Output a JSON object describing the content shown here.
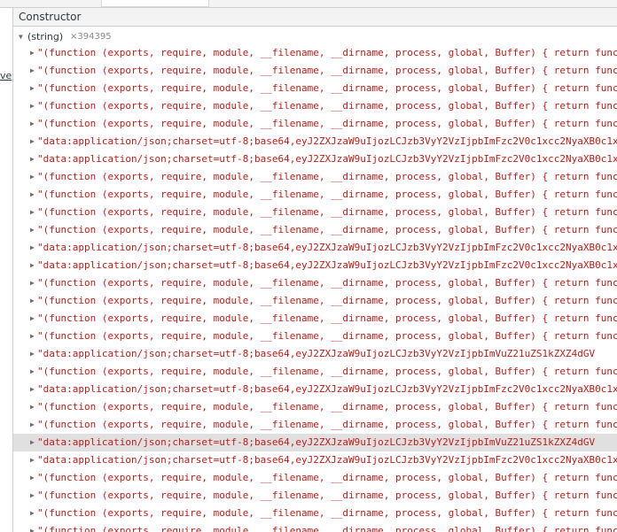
{
  "header": {
    "title": "Constructor"
  },
  "left_gutter": {
    "cut_link": "ve"
  },
  "group": {
    "name": "(string)",
    "count": "×394395"
  },
  "rows": [
    {
      "text": "\"(function (exports, require, module, __filename, __dirname, process, global, Buffer) { return func"
    },
    {
      "text": "\"(function (exports, require, module, __filename, __dirname, process, global, Buffer) { return func"
    },
    {
      "text": "\"(function (exports, require, module, __filename, __dirname, process, global, Buffer) { return func"
    },
    {
      "text": "\"(function (exports, require, module, __filename, __dirname, process, global, Buffer) { return func"
    },
    {
      "text": "\"(function (exports, require, module, __filename, __dirname, process, global, Buffer) { return func"
    },
    {
      "text": "\"data:application/json;charset=utf-8;base64,eyJ2ZXJzaW9uIjozLCJzb3VyY2VzIjpbImFzc2V0c1xcc2NyaXB0c1x"
    },
    {
      "text": "\"data:application/json;charset=utf-8;base64,eyJ2ZXJzaW9uIjozLCJzb3VyY2VzIjpbImFzc2V0c1xcc2NyaXB0c1x"
    },
    {
      "text": "\"(function (exports, require, module, __filename, __dirname, process, global, Buffer) { return func"
    },
    {
      "text": "\"(function (exports, require, module, __filename, __dirname, process, global, Buffer) { return func"
    },
    {
      "text": "\"(function (exports, require, module, __filename, __dirname, process, global, Buffer) { return func"
    },
    {
      "text": "\"(function (exports, require, module, __filename, __dirname, process, global, Buffer) { return func"
    },
    {
      "text": "\"data:application/json;charset=utf-8;base64,eyJ2ZXJzaW9uIjozLCJzb3VyY2VzIjpbImFzc2V0c1xcc2NyaXB0c1x"
    },
    {
      "text": "\"data:application/json;charset=utf-8;base64,eyJ2ZXJzaW9uIjozLCJzb3VyY2VzIjpbImFzc2V0c1xcc2NyaXB0c1x"
    },
    {
      "text": "\"(function (exports, require, module, __filename, __dirname, process, global, Buffer) { return func"
    },
    {
      "text": "\"(function (exports, require, module, __filename, __dirname, process, global, Buffer) { return func"
    },
    {
      "text": "\"(function (exports, require, module, __filename, __dirname, process, global, Buffer) { return func"
    },
    {
      "text": "\"(function (exports, require, module, __filename, __dirname, process, global, Buffer) { return func"
    },
    {
      "text": "\"data:application/json;charset=utf-8;base64,eyJ2ZXJzaW9uIjozLCJzb3VyY2VzIjpbImVuZ21uZS1kZXZ4dGV"
    },
    {
      "text": "\"(function (exports, require, module, __filename, __dirname, process, global, Buffer) { return func"
    },
    {
      "text": "\"data:application/json;charset=utf-8;base64,eyJ2ZXJzaW9uIjozLCJzb3VyY2VzIjpbImFzc2V0c1xcc2NyaXB0c1x"
    },
    {
      "text": "\"(function (exports, require, module, __filename, __dirname, process, global, Buffer) { return func"
    },
    {
      "text": "\"(function (exports, require, module, __filename, __dirname, process, global, Buffer) { return func"
    },
    {
      "text": "\"data:application/json;charset=utf-8;base64,eyJ2ZXJzaW9uIjozLCJzb3VyY2VzIjpbImVuZ21uZS1kZXZ4dGV",
      "selected": true
    },
    {
      "text": "\"data:application/json;charset=utf-8;base64,eyJ2ZXJzaW9uIjozLCJzb3VyY2VzIjpbImFzc2V0c1xcc2NyaXB0c1x"
    },
    {
      "text": "\"(function (exports, require, module, __filename, __dirname, process, global, Buffer) { return func"
    },
    {
      "text": "\"(function (exports, require, module, __filename, __dirname, process, global, Buffer) { return func"
    },
    {
      "text": "\"(function (exports, require, module, __filename, __dirname, process, global, Buffer) { return func"
    },
    {
      "text": "\"(function (exports, require, module, __filename, __dirname, process, global, Buffer) { return func"
    }
  ],
  "colors": {
    "string_value": "#c41a16",
    "selected_row": "#e0e0e0",
    "header_bg": "#f3f3f3"
  },
  "icons": {
    "expand": "triangle-down-icon",
    "collapsed": "triangle-right-icon"
  }
}
